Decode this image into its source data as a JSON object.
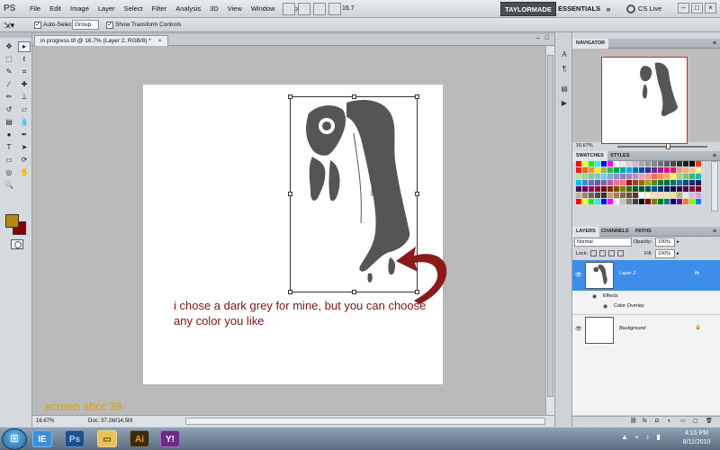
{
  "app": {
    "logo": "PS"
  },
  "menubar": {
    "items": [
      "File",
      "Edit",
      "Image",
      "Layer",
      "Select",
      "Filter",
      "Analysis",
      "3D",
      "View",
      "Window",
      "Help"
    ],
    "zoom_display": "16.7",
    "workspace_active": "TAYLORMADE",
    "workspace_essentials": "ESSENTIALS",
    "workspace_more": "»",
    "cs_live": "CS Live",
    "win_min": "–",
    "win_max": "□",
    "win_close": "×"
  },
  "options_bar": {
    "auto_select_label": "Auto-Select:",
    "auto_select_checked": true,
    "auto_select_value": "Group",
    "show_transform_label": "Show Transform Controls",
    "show_transform_checked": true
  },
  "document": {
    "tab_title": "in progress.tif @ 16.7% (Layer 2, RGB/8) *",
    "tab_close": "×",
    "zoom": "16.67%",
    "doc_info": "Doc: 37.1M/14.5M"
  },
  "annotation_text": "i chose a dark grey for mine, but you can choose any color you like",
  "screenshot_label": "screen shot 38",
  "colors": {
    "foreground": "#b8860b",
    "background": "#8b0000",
    "annotation": "#7a1414",
    "arrow": "#8b1a1a",
    "label": "#d4a017",
    "selection": "#3d8eea"
  },
  "panels": {
    "navigator_tab": "NAVIGATOR",
    "navigator_zoom": "16.67%",
    "swatches_tab": "SWATCHES",
    "styles_tab": "STYLES",
    "layers_tab": "LAYERS",
    "channels_tab": "CHANNELS",
    "paths_tab": "PATHS",
    "blend_mode": "Normal",
    "opacity_label": "Opacity:",
    "opacity_value": "100%",
    "fill_label": "Fill:",
    "fill_value": "100%",
    "lock_label": "Lock:",
    "layers": [
      {
        "name": "Layer 2",
        "fx": "fx",
        "effects_label": "Effects",
        "effect": "Color Overlay"
      },
      {
        "name": "Background",
        "lock": "🔒"
      }
    ]
  },
  "swatches": [
    "#ff0000",
    "#ffff00",
    "#00ff00",
    "#00ffff",
    "#0000ff",
    "#ff00ff",
    "#ffffff",
    "#ebebeb",
    "#d6d6d6",
    "#c2c2c2",
    "#adadad",
    "#999999",
    "#858585",
    "#707070",
    "#5c5c5c",
    "#474747",
    "#333333",
    "#1f1f1f",
    "#000000",
    "#ff3300",
    "#ed1c24",
    "#f26522",
    "#f7941d",
    "#fff200",
    "#8dc73f",
    "#39b54a",
    "#00a651",
    "#00a99d",
    "#00aeef",
    "#0072bc",
    "#0054a6",
    "#2e3192",
    "#662d91",
    "#92278f",
    "#ec008c",
    "#ed145b",
    "#f7977a",
    "#f9ad81",
    "#fdc68a",
    "#fff79a",
    "#c4df9b",
    "#a3d39c",
    "#82ca9d",
    "#7accc8",
    "#6dcff6",
    "#7da7d9",
    "#8393ca",
    "#8781bd",
    "#a186be",
    "#bd8cbf",
    "#f49ac2",
    "#f6989d",
    "#f26c4f",
    "#f68e56",
    "#fbaf5d",
    "#fff568",
    "#acd372",
    "#7cc576",
    "#3bb878",
    "#1abbb4",
    "#00bff3",
    "#438ccb",
    "#5574b9",
    "#605ca8",
    "#855fa8",
    "#a763a8",
    "#f06eaa",
    "#f26d7d",
    "#9e0b0f",
    "#a0410d",
    "#a36209",
    "#aba000",
    "#598527",
    "#1a7b30",
    "#007236",
    "#00746b",
    "#0076a3",
    "#004b80",
    "#003471",
    "#1b1464",
    "#440e62",
    "#630460",
    "#9e005d",
    "#9e0039",
    "#790000",
    "#7b2e00",
    "#7d4900",
    "#827b00",
    "#406618",
    "#005e20",
    "#005826",
    "#005952",
    "#005b7f",
    "#003663",
    "#002157",
    "#0d004c",
    "#32004b",
    "#4b0049",
    "#7b0046",
    "#7a0026",
    "#c7b299",
    "#998675",
    "#736357",
    "#534741",
    "#37302d",
    "#c69c6d",
    "#a67c52",
    "#8c6239",
    "#754c24",
    "#603913",
    "#ffffff",
    "#fffabb",
    "#ffe4b5",
    "#ffdab9",
    "#eee8aa",
    "#f0e68c",
    "#bdb76b",
    "#e6e6fa",
    "#d8bfd8",
    "#dda0dd",
    "#ff0000",
    "#ffff00",
    "#00ff00",
    "#00ffff",
    "#0000ff",
    "#ff00ff",
    "#ffffff",
    "#c0c0c0",
    "#808080",
    "#404040",
    "#000000",
    "#800000",
    "#808000",
    "#008000",
    "#008080",
    "#000080",
    "#800080",
    "#ff8000",
    "#80ff00",
    "#0080ff"
  ],
  "taskbar": {
    "clock_time": "4:15 PM",
    "clock_date": "8/11/2010",
    "apps": [
      "IE",
      "Ps",
      "Folder",
      "Ai",
      "Y!"
    ]
  }
}
